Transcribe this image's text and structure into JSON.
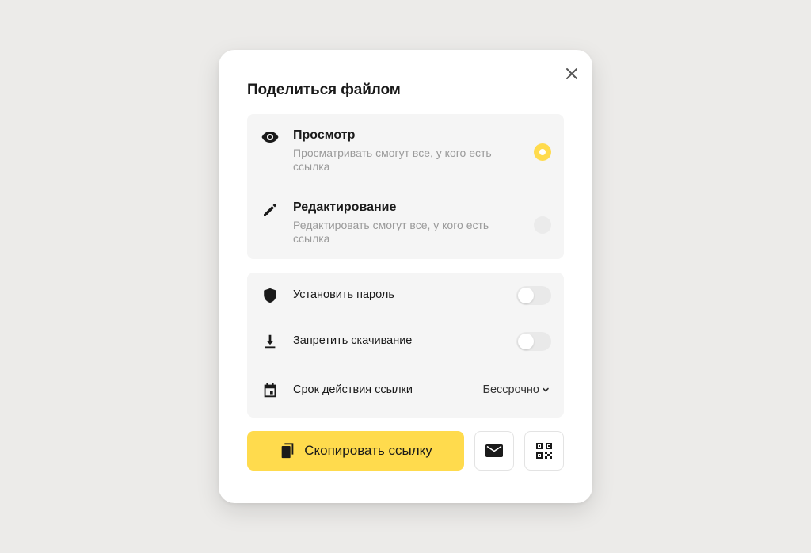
{
  "dialog": {
    "title": "Поделиться файлом",
    "close_icon": "close-icon"
  },
  "access": {
    "options": [
      {
        "icon": "eye-icon",
        "title": "Просмотр",
        "description": "Просматривать смогут все, у кого есть ссылка",
        "selected": true
      },
      {
        "icon": "pencil-icon",
        "title": "Редактирование",
        "description": "Редактировать смогут все, у кого есть ссылка",
        "selected": false
      }
    ]
  },
  "settings": {
    "password": {
      "icon": "shield-icon",
      "label": "Установить пароль",
      "enabled": false
    },
    "no_download": {
      "icon": "download-icon",
      "label": "Запретить скачивание",
      "enabled": false
    },
    "expiry": {
      "icon": "calendar-icon",
      "label": "Срок действия ссылки",
      "value": "Бессрочно"
    }
  },
  "actions": {
    "copy_label": "Скопировать ссылку",
    "copy_icon": "copy-icon",
    "mail_icon": "mail-icon",
    "qr_icon": "qr-code-icon"
  },
  "colors": {
    "accent": "#ffdb4d",
    "background": "#ecebe9",
    "panel": "#f5f5f5",
    "muted_text": "#9a9a9a"
  }
}
